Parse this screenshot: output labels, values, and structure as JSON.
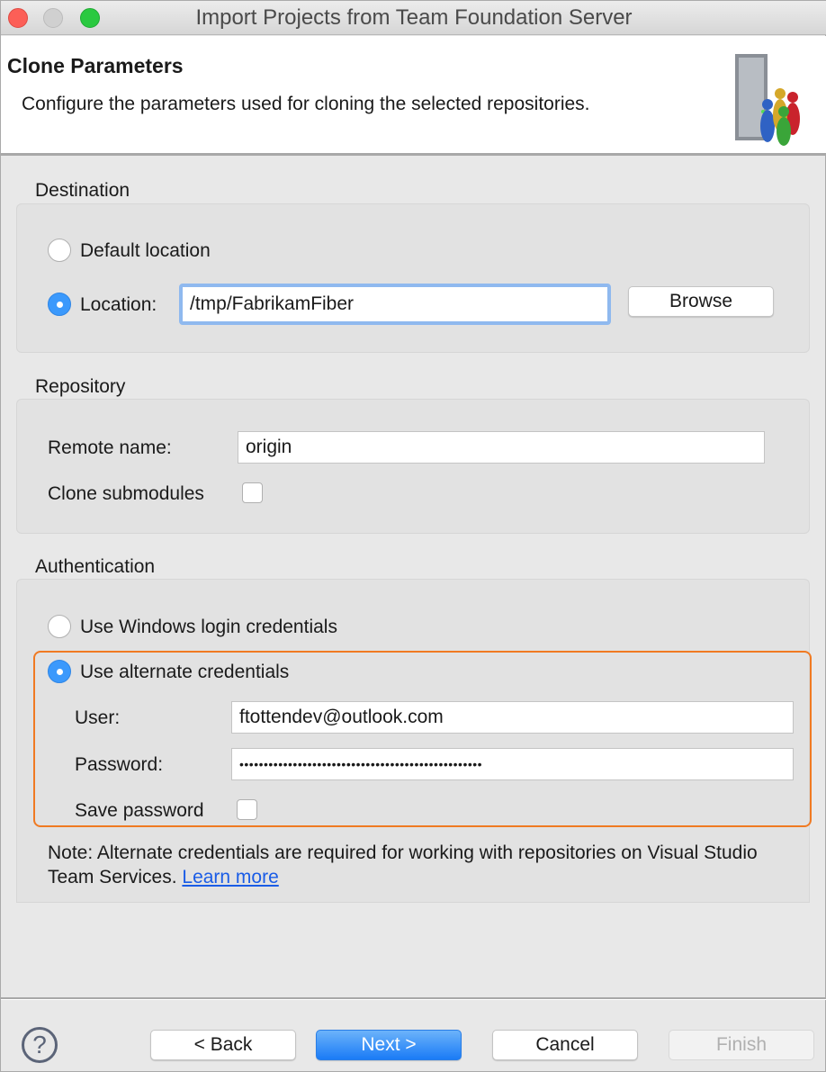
{
  "window": {
    "title": "Import Projects from Team Foundation Server"
  },
  "header": {
    "title": "Clone Parameters",
    "description": "Configure the parameters used for cloning the selected repositories."
  },
  "destination": {
    "legend": "Destination",
    "default_label": "Default location",
    "location_label": "Location:",
    "location_value": "/tmp/FabrikamFiber",
    "browse": "Browse",
    "selected": "location"
  },
  "repository": {
    "legend": "Repository",
    "remote_label": "Remote name:",
    "remote_value": "origin",
    "submodules_label": "Clone submodules",
    "submodules_checked": false
  },
  "authentication": {
    "legend": "Authentication",
    "windows_label": "Use Windows login credentials",
    "alternate_label": "Use alternate credentials",
    "selected": "alternate",
    "user_label": "User:",
    "user_value": "ftottendev@outlook.com",
    "password_label": "Password:",
    "password_value": "••••••••••••••••••••••••••••••••••••••••••••••••••",
    "save_label": "Save password",
    "save_checked": false,
    "note": "Note: Alternate credentials are required for working with repositories on Visual Studio Team Services.",
    "learn_more": "Learn more"
  },
  "footer": {
    "back": "< Back",
    "next": "Next >",
    "cancel": "Cancel",
    "finish": "Finish"
  },
  "colors": {
    "accent": "#3b99fc",
    "highlight": "#f07a22",
    "link": "#1a5ce6"
  }
}
